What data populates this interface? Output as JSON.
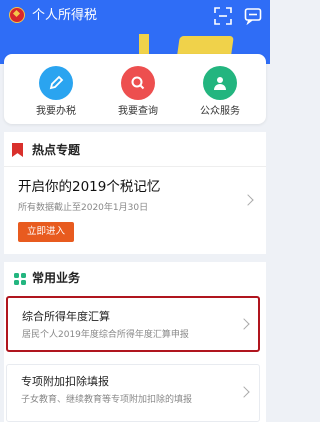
{
  "header": {
    "title": "个人所得税",
    "emblem_icon": "tax-emblem-icon",
    "scan_icon": "scan-icon",
    "message_icon": "message-icon"
  },
  "services": [
    {
      "label": "我要办税",
      "icon": "pen-icon",
      "color": "#2aa4f0"
    },
    {
      "label": "我要查询",
      "icon": "search-icon",
      "color": "#ed4f4f"
    },
    {
      "label": "公众服务",
      "icon": "service-icon",
      "color": "#23b57f"
    }
  ],
  "hot_topics": {
    "heading": "热点专题",
    "title": "开启你的2019个税记忆",
    "subtitle": "所有数据截止至2020年1月30日",
    "button_label": "立即进入"
  },
  "common_business": {
    "heading": "常用业务",
    "items": [
      {
        "title": "综合所得年度汇算",
        "description": "居民个人2019年度综合所得年度汇算申报"
      },
      {
        "title": "专项附加扣除填报",
        "description": "子女教育、继续教育等专项附加扣除的填报"
      }
    ]
  },
  "colors": {
    "brand_blue": "#2f6df6",
    "highlight_red": "#b0151e",
    "button_orange": "#e85b1f"
  }
}
